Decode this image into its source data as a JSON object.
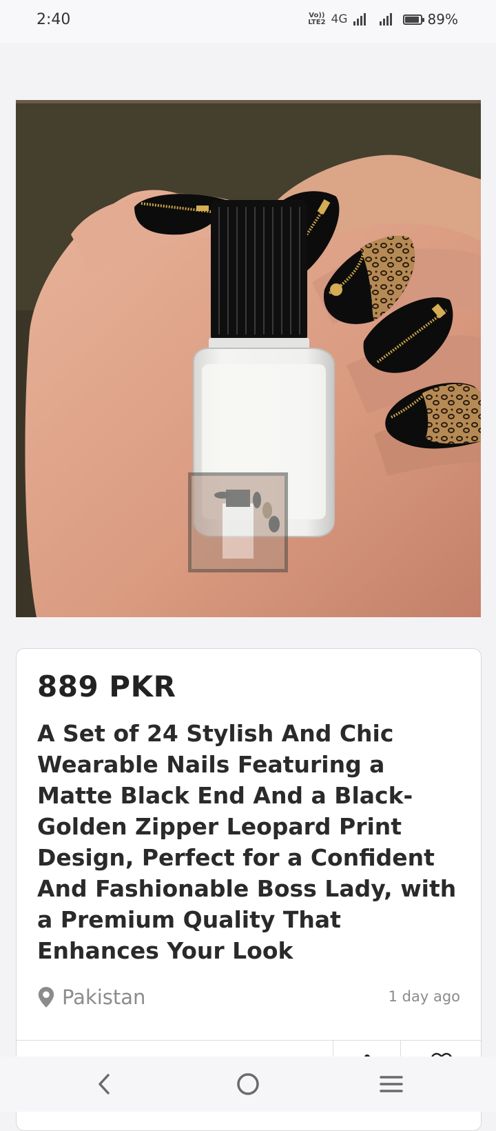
{
  "status_bar": {
    "time": "2:40",
    "volte_line1": "Vo))",
    "volte_line2": "LTE2",
    "network": "4G",
    "battery_percent": "89%",
    "battery_level": 0.89
  },
  "listing": {
    "image_icon": "product-photo-nail-set",
    "price": "889 PKR",
    "title": "A Set of 24 Stylish And Chic Wearable Nails Featuring a Matte Black End And a Black-Golden Zipper Leopard Print Design, Perfect for a Confident And Fashionable Boss Lady, with a Premium Quality That Enhances Your Look",
    "location": "Pakistan",
    "posted": "1 day ago"
  },
  "actions": {
    "more_icon": "more-vert-icon",
    "favorite_icon": "heart-icon"
  },
  "nav": {
    "back_icon": "back-icon",
    "home_icon": "home-icon",
    "menu_icon": "menu-icon"
  },
  "colors": {
    "background": "#f3f3f6",
    "card": "#ffffff",
    "text_primary": "#222222",
    "text_secondary": "#8b8b8b",
    "zipper_gold": "#c9a24a",
    "nail_black": "#0c0c0c"
  }
}
